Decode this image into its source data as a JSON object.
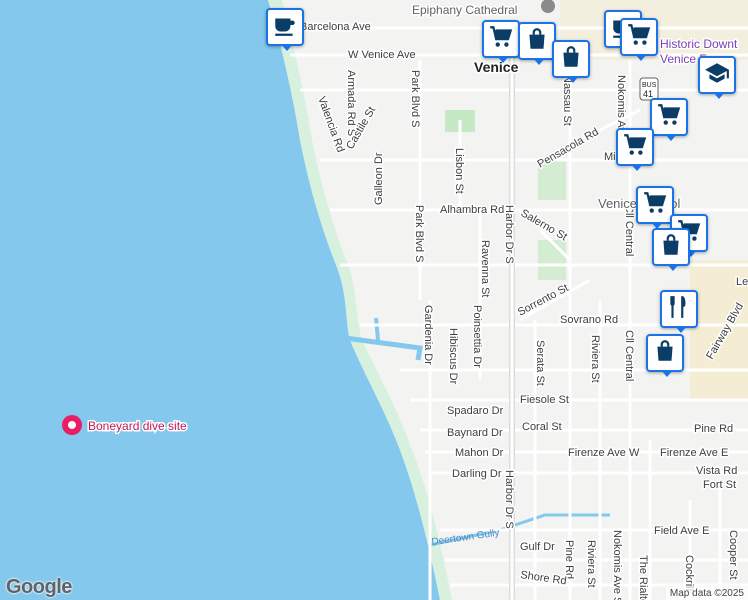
{
  "map": {
    "streets": [
      "Barcelona Ave",
      "W Venice Ave",
      "Armada Rd S",
      "Valencia Rd",
      "Castile St",
      "Park Blvd S",
      "Galleon Dr",
      "Lisbon St",
      "Alhambra Rd",
      "Park Blvd S",
      "Harbor Dr S",
      "Ravenna St",
      "Salerno St",
      "Sorrento St",
      "Sovrano Rd",
      "Gardenia Dr",
      "Hibiscus Dr",
      "Poinsettia Dr",
      "Serata St",
      "Riviera St",
      "Cll Central",
      "Fiesole St",
      "Spadaro Dr",
      "Coral St",
      "Baynard Dr",
      "Pine Rd",
      "Mahon Dr",
      "Firenze Ave W",
      "Firenze Ave E",
      "Vista Rd",
      "Darling Dr",
      "Fort St",
      "Harbor Dr S",
      "Field Ave E",
      "Deertown Gully",
      "Gulf Dr",
      "Pine Rd",
      "Riviera St",
      "Nokomis Ave S",
      "The Rialto",
      "Cockrill",
      "Cooper St",
      "Shore Rd",
      "Pensacola Rd",
      "Milan Av",
      "Nassau St",
      "Nokomis Av",
      "Cll Central",
      "Fairway Blvd",
      "Le"
    ],
    "places": {
      "cathedral": "Epiphany Cathedral",
      "city": "Venice",
      "historic": "Historic Downt Venice F",
      "school": "Venice School",
      "dive_site": "Boneyard dive site",
      "route_shield": "BUS 41"
    },
    "markers": [
      {
        "type": "coffee-icon"
      },
      {
        "type": "shopping-cart-icon"
      },
      {
        "type": "shopping-bag-icon"
      },
      {
        "type": "shopping-bag-icon"
      },
      {
        "type": "coffee-icon"
      },
      {
        "type": "shopping-cart-icon"
      },
      {
        "type": "shopping-cart-icon"
      },
      {
        "type": "graduation-cap-icon"
      },
      {
        "type": "shopping-cart-icon"
      },
      {
        "type": "shopping-cart-icon"
      },
      {
        "type": "shopping-cart-icon"
      },
      {
        "type": "shopping-bag-icon"
      },
      {
        "type": "restaurant-icon"
      },
      {
        "type": "shopping-bag-icon"
      }
    ],
    "colors": {
      "water": "#84c8ee",
      "land": "#f3f3f1",
      "beach": "#d8f0de",
      "road": "#ffffff",
      "highway": "#dcdcdc",
      "park": "#c5e8c5",
      "marker_border": "#1a73e8",
      "marker_icon": "#0b3d66"
    }
  },
  "footer": {
    "logo": "Google",
    "attribution": "Map data ©2025"
  }
}
